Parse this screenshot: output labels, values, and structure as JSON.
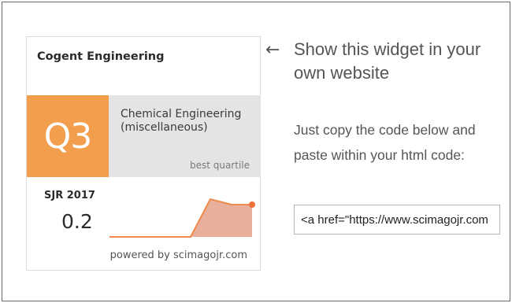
{
  "widget": {
    "journal_title": "Cogent Engineering",
    "quartile": "Q3",
    "category": "Chemical Engineering (miscellaneous)",
    "best_quartile_label": "best quartile",
    "sjr_label": "SJR 2017",
    "sjr_value": "0.2",
    "powered_by": "powered by scimagojr.com",
    "colors": {
      "quartile_bg": "#f29e4c",
      "category_bg": "#e4e4e4",
      "trend_line": "#ef8a4c",
      "trend_fill": "#e8b09a"
    }
  },
  "side": {
    "arrow": "←",
    "heading": "Show this widget in your own website",
    "instructions": "Just copy the code below and paste within your html code:",
    "code_value": "<a href=\"https://www.scimagojr.com"
  }
}
